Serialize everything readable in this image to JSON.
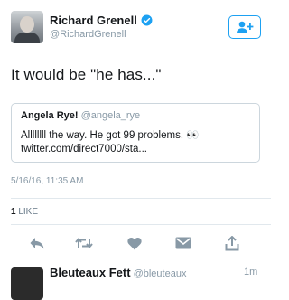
{
  "author": {
    "name": "Richard Grenell",
    "handle": "@RichardGrenell"
  },
  "tweet": {
    "text": "It would be \"he has...\"",
    "timestamp": "5/16/16, 11:35 AM"
  },
  "quote": {
    "name": "Angela Rye!",
    "handle": "@angela_rye",
    "line1": "Allllllll the way. He got 99 problems. 👀",
    "line2": "twitter.com/direct7000/sta..."
  },
  "stats": {
    "like_count": "1",
    "like_label": "LIKE"
  },
  "next_tweet": {
    "name": "Bleuteaux Fett",
    "handle": "@bleuteaux",
    "time": "1m"
  },
  "colors": {
    "accent": "#1da1f2",
    "muted": "#8899a6",
    "icon": "#8899a6"
  }
}
